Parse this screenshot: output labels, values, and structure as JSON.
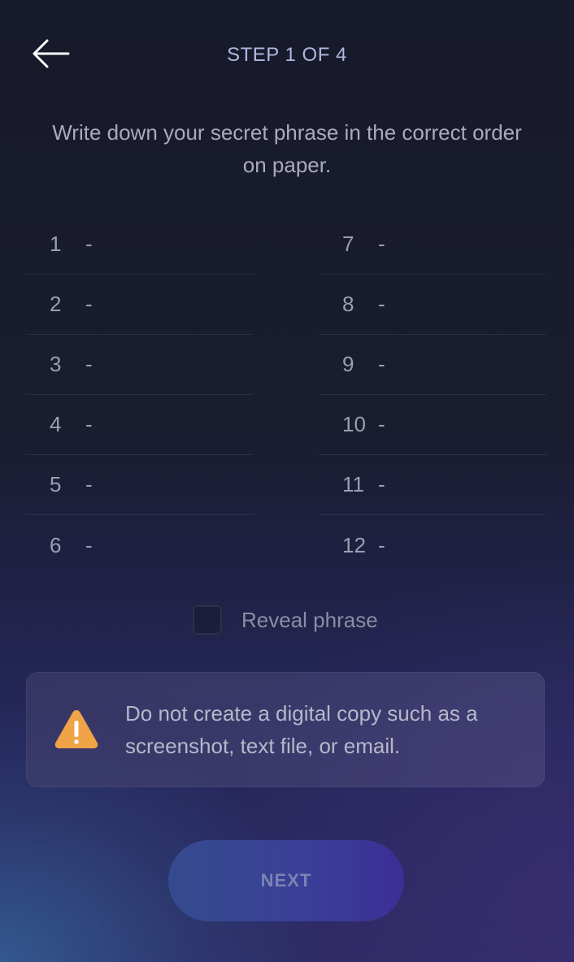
{
  "header": {
    "back_icon": "arrow-left-icon",
    "step_label": "STEP 1 OF 4"
  },
  "instructions": "Write down your secret phrase in the correct order on paper.",
  "phrase": {
    "left_column": [
      {
        "number": "1",
        "word": "-"
      },
      {
        "number": "2",
        "word": "-"
      },
      {
        "number": "3",
        "word": "-"
      },
      {
        "number": "4",
        "word": "-"
      },
      {
        "number": "5",
        "word": "-"
      },
      {
        "number": "6",
        "word": "-"
      }
    ],
    "right_column": [
      {
        "number": "7",
        "word": "-"
      },
      {
        "number": "8",
        "word": "-"
      },
      {
        "number": "9",
        "word": "-"
      },
      {
        "number": "10",
        "word": "-"
      },
      {
        "number": "11",
        "word": "-"
      },
      {
        "number": "12",
        "word": "-"
      }
    ]
  },
  "reveal": {
    "label": "Reveal phrase",
    "checked": false
  },
  "warning": {
    "icon": "warning-triangle-icon",
    "text": "Do not create a digital copy such as a screenshot, text file, or email.",
    "icon_color": "#f0a347"
  },
  "footer": {
    "next_label": "NEXT"
  }
}
